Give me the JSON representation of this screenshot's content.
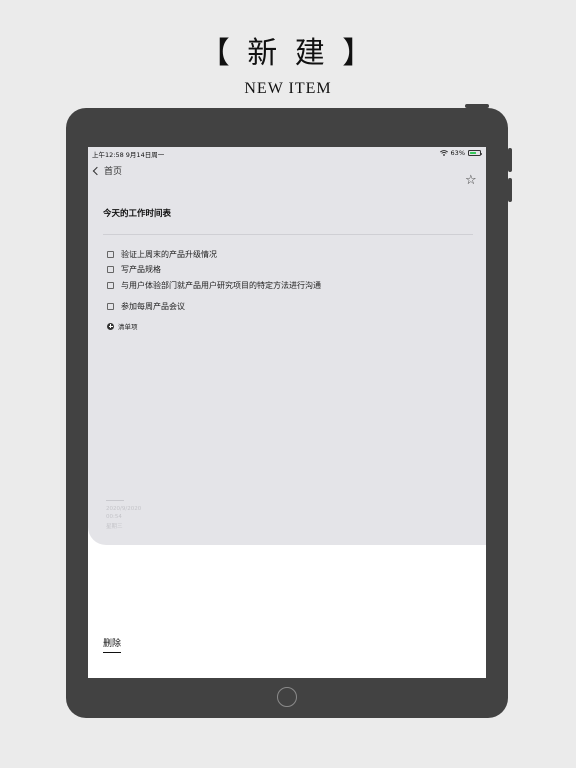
{
  "header": {
    "title": "【 新 建 】",
    "subtitle": "NEW ITEM"
  },
  "statusbar": {
    "time_date": "上午12:58   9月14日周一",
    "battery_percent": "63%",
    "battery_level": 0.63,
    "wifi_icon": "wifi-icon",
    "battery_color": "#34c759"
  },
  "nav": {
    "back_label": "首页",
    "back_icon": "chevron-left-icon",
    "star_icon": "☆"
  },
  "note": {
    "title": "今天的工作时间表",
    "items": [
      {
        "label": "验证上周末的产品升级情况",
        "checked": false
      },
      {
        "label": "写产品规格",
        "checked": false
      },
      {
        "label": "与用户体验部门就产品用户研究项目的特定方法进行沟通",
        "checked": false
      },
      {
        "label": "参加每周产品会议",
        "checked": false
      }
    ],
    "add_item_label": "清单项",
    "meta": [
      "2020/9/2020",
      "00:54",
      "星期三"
    ]
  },
  "footer": {
    "delete_label": "删除"
  },
  "colors": {
    "background": "#ebebeb",
    "device": "#424242",
    "card": "#e4e4e8"
  }
}
